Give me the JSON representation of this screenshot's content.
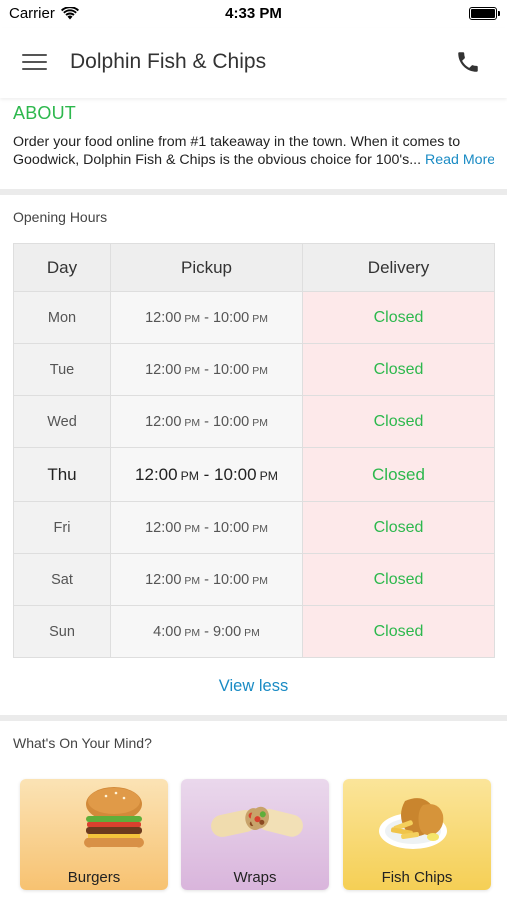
{
  "status_bar": {
    "carrier": "Carrier",
    "time": "4:33 PM"
  },
  "header": {
    "title": "Dolphin Fish & Chips",
    "menu_icon": "hamburger-menu-icon",
    "phone_icon": "phone-icon"
  },
  "about": {
    "heading": "ABOUT",
    "line1": "Order your food online from #1 takeaway in the town. When it comes to",
    "line2": "Goodwick, Dolphin Fish & Chips is the obvious choice for 100's",
    "ellipsis": "...",
    "read_more": "Read More"
  },
  "opening_hours": {
    "title": "Opening Hours",
    "columns": [
      "Day",
      "Pickup",
      "Delivery"
    ],
    "rows": [
      {
        "day": "Mon",
        "pickup_start": "12:00",
        "pickup_start_ampm": "PM",
        "pickup_end": "10:00",
        "pickup_end_ampm": "PM",
        "delivery": "Closed"
      },
      {
        "day": "Tue",
        "pickup_start": "12:00",
        "pickup_start_ampm": "PM",
        "pickup_end": "10:00",
        "pickup_end_ampm": "PM",
        "delivery": "Closed"
      },
      {
        "day": "Wed",
        "pickup_start": "12:00",
        "pickup_start_ampm": "PM",
        "pickup_end": "10:00",
        "pickup_end_ampm": "PM",
        "delivery": "Closed"
      },
      {
        "day": "Thu",
        "pickup_start": "12:00",
        "pickup_start_ampm": "PM",
        "pickup_end": "10:00",
        "pickup_end_ampm": "PM",
        "delivery": "Closed"
      },
      {
        "day": "Fri",
        "pickup_start": "12:00",
        "pickup_start_ampm": "PM",
        "pickup_end": "10:00",
        "pickup_end_ampm": "PM",
        "delivery": "Closed"
      },
      {
        "day": "Sat",
        "pickup_start": "12:00",
        "pickup_start_ampm": "PM",
        "pickup_end": "10:00",
        "pickup_end_ampm": "PM",
        "delivery": "Closed"
      },
      {
        "day": "Sun",
        "pickup_start": "4:00",
        "pickup_start_ampm": "PM",
        "pickup_end": "9:00",
        "pickup_end_ampm": "PM",
        "delivery": "Closed"
      }
    ],
    "view_less": "View less"
  },
  "mind": {
    "title": "What's On Your Mind?",
    "categories": [
      {
        "label": "Burgers",
        "icon": "burger-image"
      },
      {
        "label": "Wraps",
        "icon": "wraps-image"
      },
      {
        "label": "Fish  Chips",
        "icon": "fish-chips-image"
      }
    ]
  },
  "colors": {
    "accent_green": "#2db84d",
    "link_blue": "#1a8bc4",
    "closed_cell_bg": "#fde9ea"
  }
}
